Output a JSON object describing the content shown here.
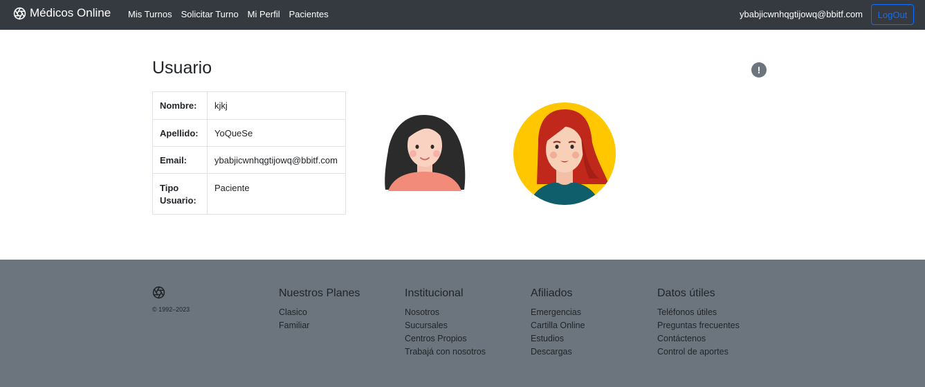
{
  "navbar": {
    "brand": "Médicos Online",
    "links": [
      "Mis Turnos",
      "Solicitar Turno",
      "Mi Perfil",
      "Pacientes"
    ],
    "user_email": "ybabjicwnhqgtijowq@bbitf.com",
    "logout_label": "LogOut"
  },
  "main": {
    "title": "Usuario",
    "info_icon": "!",
    "user": {
      "nombre_label": "Nombre:",
      "nombre": "kjkj",
      "apellido_label": "Apellido:",
      "apellido": "YoQueSe",
      "email_label": "Email:",
      "email": "ybabjicwnhqgtijowq@bbitf.com",
      "tipo_label_1": "Tipo",
      "tipo_label_2": "Usuario:",
      "tipo": "Paciente"
    }
  },
  "footer": {
    "copyright": "© 1992–2023",
    "columns": [
      {
        "title": "Nuestros Planes",
        "links": [
          "Clasico",
          "Familiar"
        ]
      },
      {
        "title": "Institucional",
        "links": [
          "Nosotros",
          "Sucursales",
          "Centros Propios",
          "Trabajá con nosotros"
        ]
      },
      {
        "title": "Afiliados",
        "links": [
          "Emergencias",
          "Cartilla Online",
          "Estudios",
          "Descargas"
        ]
      },
      {
        "title": "Datos útiles",
        "links": [
          "Teléfonos útiles",
          "Preguntas frecuentes",
          "Contáctenos",
          "Control de aportes"
        ]
      }
    ]
  },
  "colors": {
    "navbar_bg": "#343a40",
    "footer_bg": "#6c757d",
    "accent": "#0d6efd"
  }
}
